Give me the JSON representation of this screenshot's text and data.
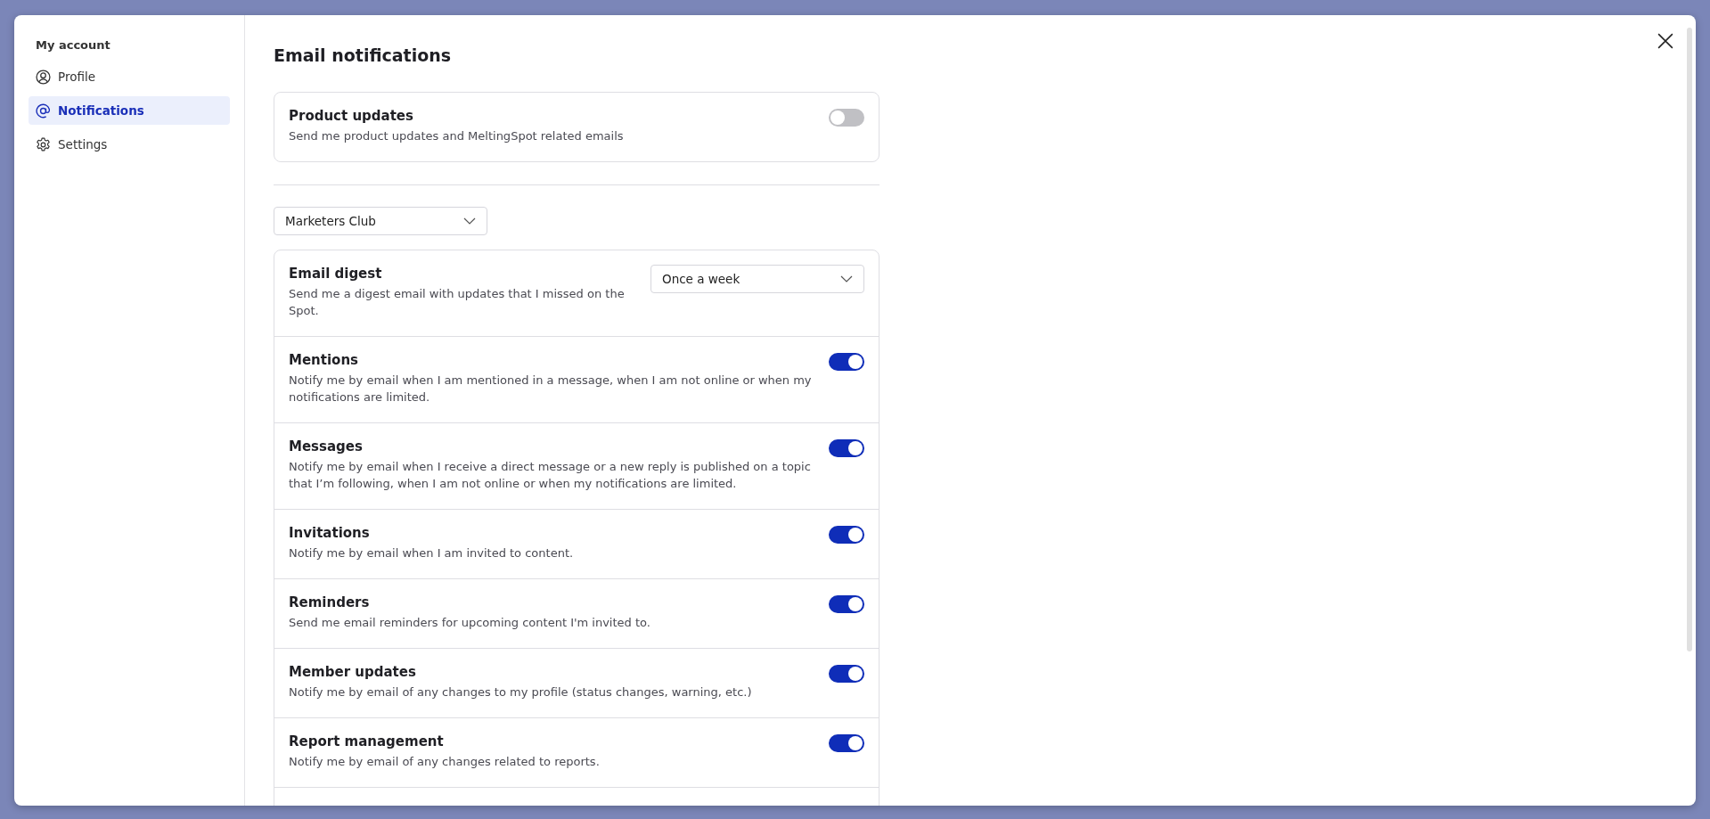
{
  "sidebar": {
    "heading": "My account",
    "items": [
      {
        "label": "Profile",
        "kind": "user",
        "selected": false
      },
      {
        "label": "Notifications",
        "kind": "at",
        "selected": true
      },
      {
        "label": "Settings",
        "kind": "gear",
        "selected": false
      }
    ]
  },
  "main": {
    "title": "Email notifications",
    "product_updates": {
      "title": "Product updates",
      "description": "Send me product updates and MeltingSpot related emails",
      "on": false
    },
    "space_select": {
      "value": "Marketers Club"
    },
    "settings": [
      {
        "kind": "select",
        "title": "Email digest",
        "description": "Send me a digest email with updates that I missed on the Spot.",
        "value": "Once a week"
      },
      {
        "kind": "toggle",
        "title": "Mentions",
        "description": "Notify me by email when I am mentioned in a message, when I am not online or when my notifications are limited.",
        "on": true
      },
      {
        "kind": "toggle",
        "title": "Messages",
        "description": "Notify me by email when I receive a direct message or a new reply is published on a topic that I’m following, when I am not online or when my notifications are limited.",
        "on": true
      },
      {
        "kind": "toggle",
        "title": "Invitations",
        "description": "Notify me by email when I am invited to content.",
        "on": true
      },
      {
        "kind": "toggle",
        "title": "Reminders",
        "description": "Send me email reminders for upcoming content I'm invited to.",
        "on": true
      },
      {
        "kind": "toggle",
        "title": "Member updates",
        "description": "Notify me by email of any changes to my profile (status changes, warning, etc.)",
        "on": true
      },
      {
        "kind": "toggle",
        "title": "Report management",
        "description": "Notify me by email of any changes related to reports.",
        "on": true
      }
    ]
  }
}
